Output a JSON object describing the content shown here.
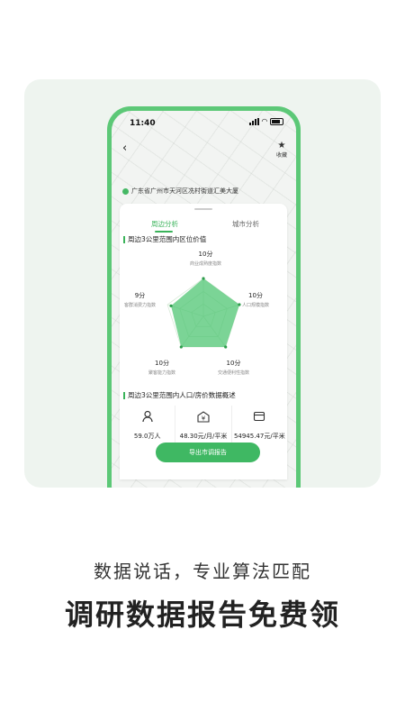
{
  "status_bar": {
    "time": "11:40"
  },
  "header": {
    "favorite_label": "收藏"
  },
  "address": "广东省广州市天河区冼村街道汇美大厦",
  "tabs": [
    {
      "label": "周边分析",
      "active": true
    },
    {
      "label": "城市分析",
      "active": false
    }
  ],
  "section1_title": "周边3公里范围内区位价值",
  "radar": {
    "max": 10,
    "axes": [
      {
        "name": "商业成熟度指数",
        "value": 10,
        "display": "10分"
      },
      {
        "name": "人口规模指数",
        "value": 10,
        "display": "10分"
      },
      {
        "name": "交通便利性指数",
        "value": 10,
        "display": "10分"
      },
      {
        "name": "聚客能力指数",
        "value": 10,
        "display": "10分"
      },
      {
        "name": "客群消费力指数",
        "value": 9,
        "display": "9分"
      }
    ]
  },
  "section2_title": "周边3公里范围内人口/房价数据概述",
  "stats": [
    {
      "icon": "person-icon",
      "value": "59.0万人"
    },
    {
      "icon": "yuan-building-icon",
      "value": "48.30元/月/平米"
    },
    {
      "icon": "wallet-icon",
      "value": "54945.47元/平米"
    }
  ],
  "export_button": "导出市调报告",
  "headline1": "数据说话，专业算法匹配",
  "headline2": "调研数据报告免费领",
  "colors": {
    "accent": "#3ab35a",
    "phone_frame": "#5cc877"
  }
}
